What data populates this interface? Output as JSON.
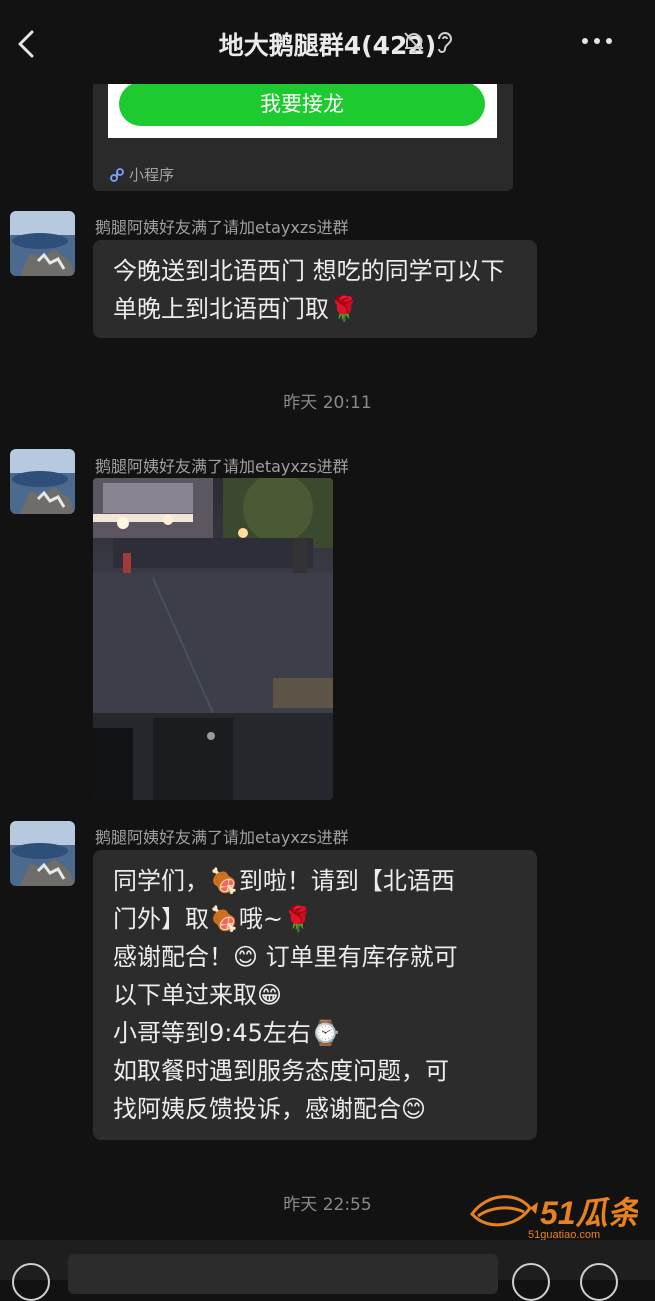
{
  "header": {
    "title": "地大鹅腿群4(422)",
    "icons": [
      "back-arrow-icon",
      "mute-bell-icon",
      "ear-icon",
      "more-icon"
    ]
  },
  "mini_program_card": {
    "button_label": "我要接龙",
    "footer_label": "小程序"
  },
  "messages": [
    {
      "sender": "鹅腿阿姨好友满了请加etayxzs进群",
      "text": "今晚送到北语西门 想吃的同学可以下单晚上到北语西门取🌹"
    },
    {
      "timestamp": "昨天 20:11"
    },
    {
      "sender": "鹅腿阿姨好友满了请加etayxzs进群",
      "image": "night-street-photo"
    },
    {
      "sender": "鹅腿阿姨好友满了请加etayxzs进群",
      "lines": [
        "同学们，🍖到啦！请到【北语西",
        "门外】取🍖哦~🌹",
        "感谢配合！😊 订单里有库存就可",
        "以下单过来取😁",
        "小哥等到9:45左右⌚",
        "如取餐时遇到服务态度问题，可",
        "找阿姨反馈投诉，感谢配合😊"
      ]
    },
    {
      "timestamp": "昨天 22:55"
    }
  ],
  "watermark": {
    "brand": "51瓜条",
    "url": "51guatiao.com"
  },
  "colors": {
    "background": "#121212",
    "bubble": "#2c2c2c",
    "accent_green": "#1dcb30",
    "watermark_orange": "#e8821e"
  }
}
